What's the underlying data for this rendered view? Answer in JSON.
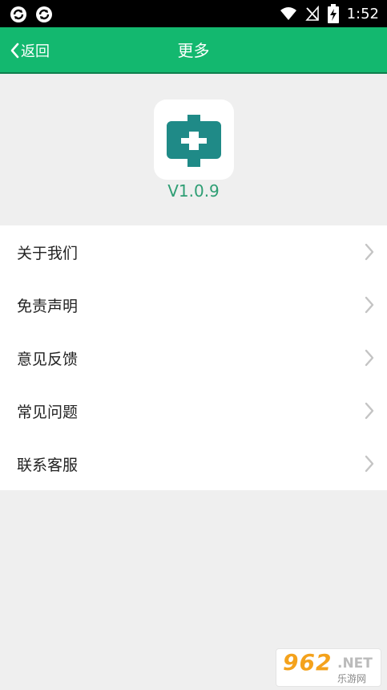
{
  "status_bar": {
    "time": "1:52",
    "battery_level": 0.7
  },
  "nav": {
    "back_label": "返回",
    "title": "更多"
  },
  "app": {
    "version": "V1.0.9",
    "logo_color": "#1f8a87"
  },
  "menu": {
    "items": [
      {
        "label": "关于我们"
      },
      {
        "label": "免责声明"
      },
      {
        "label": "意见反馈"
      },
      {
        "label": "常见问题"
      },
      {
        "label": "联系客服"
      }
    ]
  },
  "watermark": {
    "main": "962",
    "suffix": ".NET",
    "sub": "乐游网"
  },
  "colors": {
    "accent": "#13b86f",
    "version_text": "#2e9e74",
    "background": "#efefef"
  }
}
